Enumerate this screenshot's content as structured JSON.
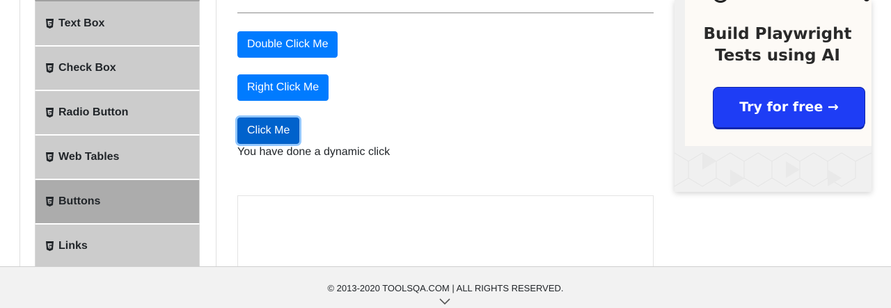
{
  "sidebar": {
    "items": [
      {
        "label": "Text Box",
        "icon": "html5-icon"
      },
      {
        "label": "Check Box",
        "icon": "html5-icon"
      },
      {
        "label": "Radio Button",
        "icon": "html5-icon"
      },
      {
        "label": "Web Tables",
        "icon": "html5-icon"
      },
      {
        "label": "Buttons",
        "icon": "html5-icon",
        "active": true
      },
      {
        "label": "Links",
        "icon": "html5-icon"
      }
    ]
  },
  "main": {
    "double_click_label": "Double Click Me",
    "right_click_label": "Right Click Me",
    "click_label": "Click Me",
    "dynamic_click_message": "You have done a dynamic click"
  },
  "ad": {
    "title_line1": "Build Playwright",
    "title_line2": "Tests using AI",
    "cta_label": "Try for free →"
  },
  "footer": {
    "copyright": "© 2013-2020 TOOLSQA.COM | ALL RIGHTS RESERVED.",
    "scroll_icon": "chevron-down-icon"
  },
  "colors": {
    "primary_button": "#007bff",
    "sidebar_item": "#cccccc",
    "sidebar_item_active": "#acacac",
    "ad_cta": "#1e3df5"
  }
}
